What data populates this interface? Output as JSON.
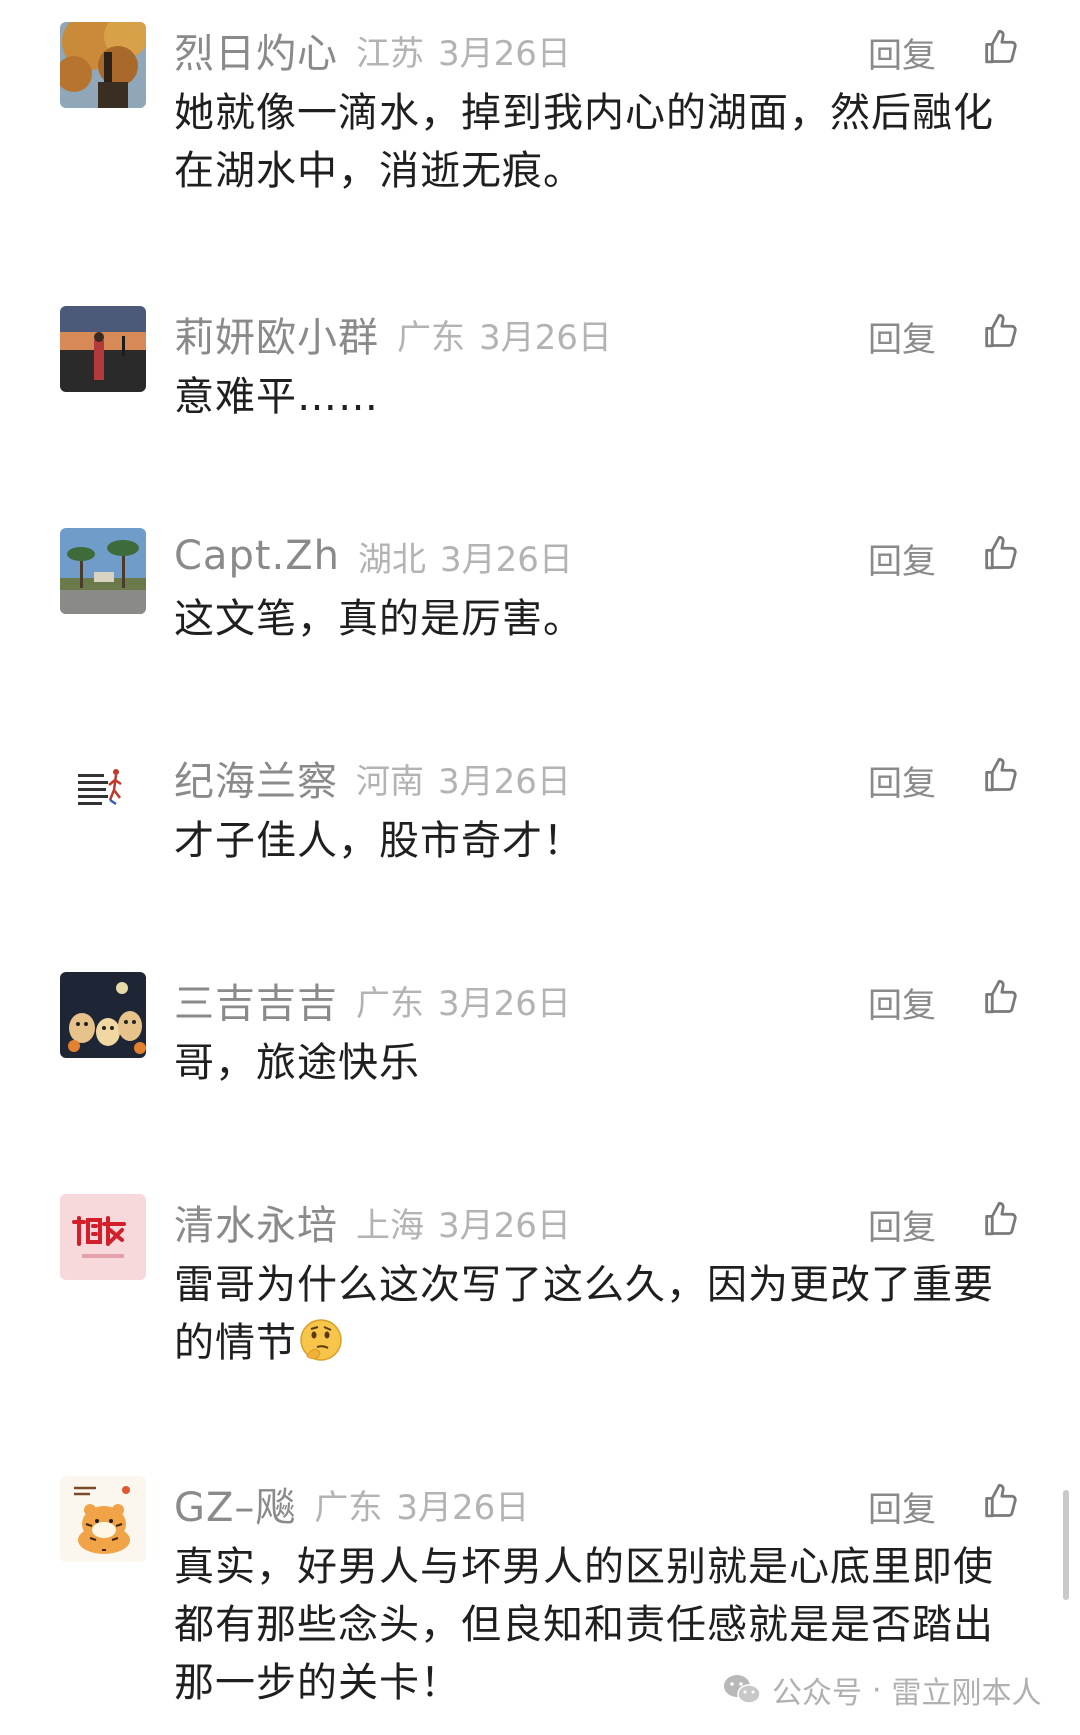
{
  "comments": [
    {
      "username": "烈日灼心",
      "region": "江苏",
      "date": "3月26日",
      "reply_label": "回复",
      "text": "她就像一滴水，掉到我内心的湖面，然后融化在湖水中，消逝无痕。",
      "avatar": "autumn-tree-avatar"
    },
    {
      "username": "莉妍欧小群",
      "region": "广东",
      "date": "3月26日",
      "reply_label": "回复",
      "text": "意难平……",
      "avatar": "sunset-person-avatar"
    },
    {
      "username": "Capt.Zh",
      "region": "湖北",
      "date": "3月26日",
      "reply_label": "回复",
      "text": "这文笔，真的是厉害。",
      "avatar": "palm-trees-avatar"
    },
    {
      "username": "纪海兰察",
      "region": "河南",
      "date": "3月26日",
      "reply_label": "回复",
      "text": "才子佳人，股市奇才！",
      "avatar": "text-runner-avatar"
    },
    {
      "username": "三吉吉吉",
      "region": "广东",
      "date": "3月26日",
      "reply_label": "回复",
      "text": "哥，旅途快乐",
      "avatar": "cartoon-dogs-avatar"
    },
    {
      "username": "清水永培",
      "region": "上海",
      "date": "3月26日",
      "reply_label": "回复",
      "text": "雷哥为什么这次写了这么久，因为更改了重要的情节",
      "text_emoji": "thinking-face-emoji",
      "avatar": "china-dream-avatar"
    },
    {
      "username": "GZ–飚",
      "region": "广东",
      "date": "3月26日",
      "reply_label": "回复",
      "text": "真实，好男人与坏男人的区别就是心底里即使都有那些念头，但良知和责任感就是是否踏出那一步的关卡！",
      "avatar": "tiger-cartoon-avatar"
    }
  ],
  "watermark": {
    "icon": "wechat-icon",
    "account_type": "公众号",
    "separator": "·",
    "author": "雷立刚本人"
  },
  "colors": {
    "username": "#8a8a8a",
    "meta": "#b3b3b3",
    "text": "#1f1f1f",
    "background": "#ffffff"
  }
}
